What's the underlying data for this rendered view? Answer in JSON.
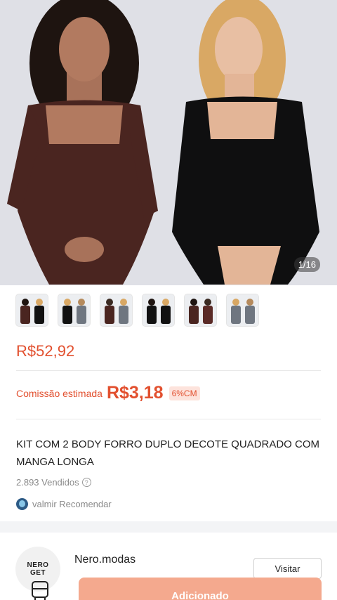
{
  "gallery": {
    "counter": "1/16",
    "thumbnail_count": 6
  },
  "product": {
    "price": "R$52,92",
    "commission_label": "Comissão estimada",
    "commission_value": "R$3,18",
    "commission_badge": "6%CM",
    "title": "KIT COM 2 BODY FORRO DUPLO DECOTE QUADRADO COM MANGA LONGA",
    "sold": "2.893 Vendidos",
    "recommend_text": "valmir Recomendar"
  },
  "store": {
    "logo_text_top": "NERO",
    "logo_text_bottom": "GET",
    "name": "Nero.modas",
    "visit_label": "Visitar"
  },
  "bottom": {
    "add_label": "Adicionado",
    "shop_icon": "store-icon"
  },
  "colors": {
    "accent": "#e2502f",
    "add_button": "#f4a98e"
  }
}
